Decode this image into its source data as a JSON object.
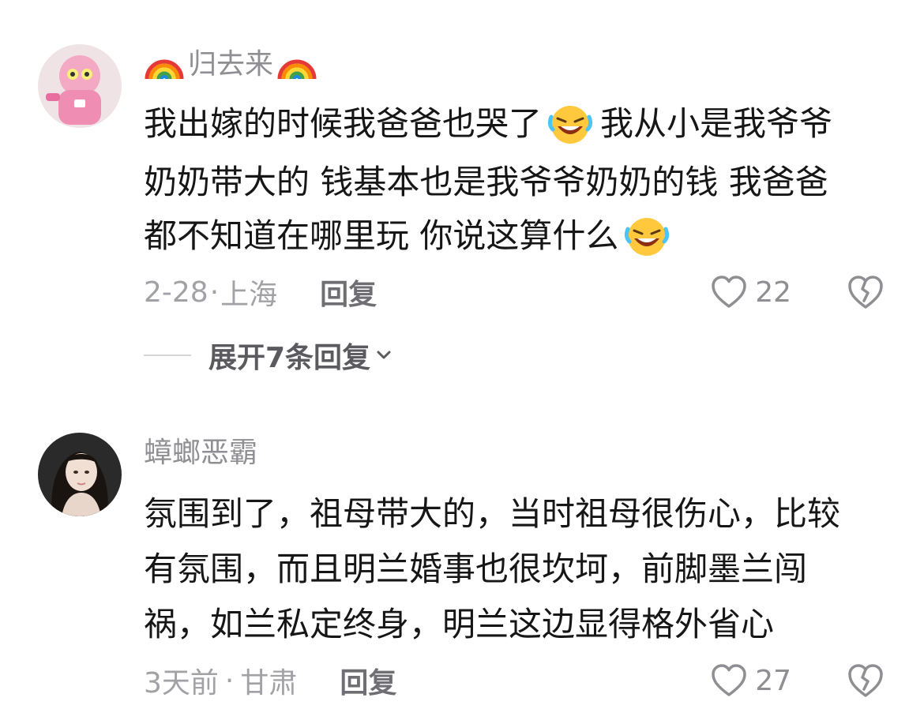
{
  "comments": [
    {
      "username": "归去来",
      "lines": [
        "我出嫁的时候我爸爸也哭了",
        "我从小是我爷爷",
        "奶奶带大的 钱基本也是我爷爷奶奶的钱 我爸爸",
        "都不知道在哪里玩 你说这算什么"
      ],
      "username_decoration": "rainbow-icon",
      "inline_emoji": "laughing-crying-icon",
      "date": "2-28",
      "location": "上海",
      "reply_label": "回复",
      "likes": "22",
      "expand_label": "展开7条回复"
    },
    {
      "username": "蟑螂恶霸",
      "lines": [
        "氛围到了，祖母带大的，当时祖母很伤心，比较",
        "有氛围，而且明兰婚事也很坎坷，前脚墨兰闯",
        "祸，如兰私定终身，明兰这边显得格外省心"
      ],
      "date": "3天前",
      "location": "甘肃",
      "reply_label": "回复",
      "likes": "27"
    }
  ],
  "meta_separator": "·",
  "colors": {
    "meta_gray": "#a1a1a6",
    "username_gray": "#8e8e93",
    "text": "#161616"
  }
}
